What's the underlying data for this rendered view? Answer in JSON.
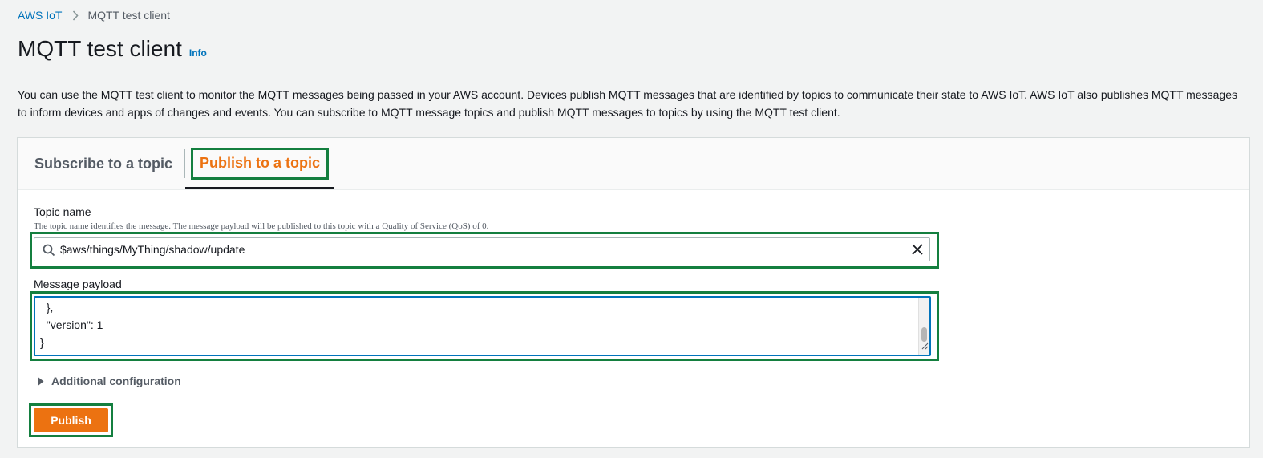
{
  "breadcrumb": {
    "root": "AWS IoT",
    "current": "MQTT test client"
  },
  "page": {
    "title": "MQTT test client",
    "info_label": "Info",
    "description": "You can use the MQTT test client to monitor the MQTT messages being passed in your AWS account. Devices publish MQTT messages that are identified by topics to communicate their state to AWS IoT. AWS IoT also publishes MQTT messages to inform devices and apps of changes and events. You can subscribe to MQTT message topics and publish MQTT messages to topics by using the MQTT test client."
  },
  "tabs": [
    {
      "label": "Subscribe to a topic",
      "selected": false
    },
    {
      "label": "Publish to a topic",
      "selected": true
    }
  ],
  "publish_form": {
    "topic_label": "Topic name",
    "topic_description": "The topic name identifies the message. The message payload will be published to this topic with a Quality of Service (QoS) of 0.",
    "topic_value": "$aws/things/MyThing/shadow/update",
    "payload_label": "Message payload",
    "payload_visible_text": "  },\n  \"version\": 1\n}",
    "additional_config_label": "Additional configuration",
    "publish_label": "Publish"
  },
  "colors": {
    "accent_orange": "#ec7211",
    "link_blue": "#0073bb",
    "highlight_green": "#147f3f"
  },
  "icons": [
    "chevron-right-icon",
    "search-icon",
    "close-icon",
    "resize-handle-icon",
    "caret-right-icon"
  ]
}
